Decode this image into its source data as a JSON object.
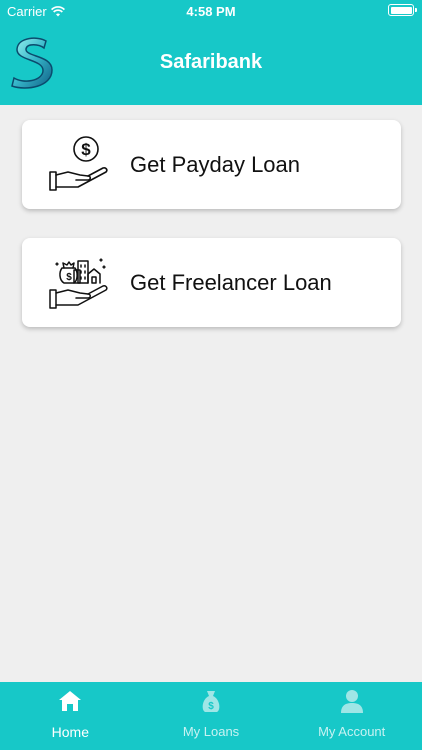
{
  "status_bar": {
    "carrier": "Carrier",
    "time": "4:58 PM"
  },
  "header": {
    "title": "Safaribank",
    "logo_icon": "s-logo-icon"
  },
  "loan_options": [
    {
      "label": "Get Payday Loan",
      "icon": "hand-dollar-coin-icon"
    },
    {
      "label": "Get Freelancer Loan",
      "icon": "hand-city-money-icon"
    }
  ],
  "tabbar": {
    "tabs": [
      {
        "label": "Home",
        "icon": "home-icon",
        "active": true
      },
      {
        "label": "My Loans",
        "icon": "money-bag-icon",
        "active": false
      },
      {
        "label": "My Account",
        "icon": "user-icon",
        "active": false
      }
    ]
  },
  "colors": {
    "primary": "#17c8c8",
    "background": "#efefef",
    "card": "#ffffff",
    "text": "#111111"
  }
}
